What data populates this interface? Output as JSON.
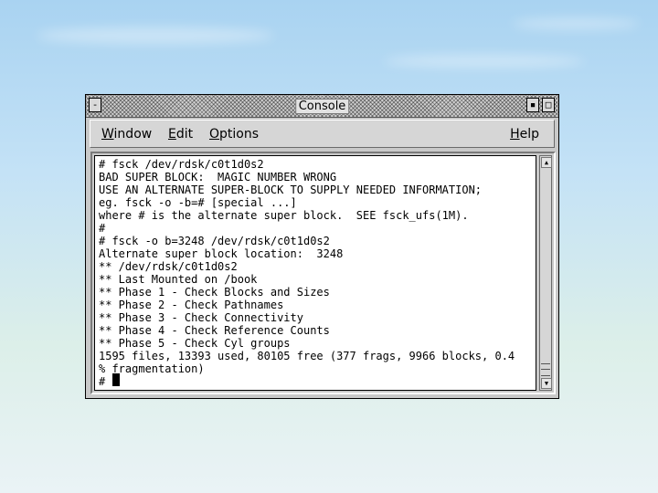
{
  "window": {
    "title": "Console",
    "menu_button_glyph": "-",
    "minimize_glyph": "▪",
    "maximize_glyph": "□"
  },
  "menubar": {
    "window_accel": "W",
    "window_rest": "indow",
    "edit_accel": "E",
    "edit_rest": "dit",
    "options_accel": "O",
    "options_rest": "ptions",
    "help_accel": "H",
    "help_rest": "elp"
  },
  "terminal": {
    "lines": [
      "# fsck /dev/rdsk/c0t1d0s2",
      "BAD SUPER BLOCK:  MAGIC NUMBER WRONG",
      "USE AN ALTERNATE SUPER-BLOCK TO SUPPLY NEEDED INFORMATION;",
      "eg. fsck -o -b=# [special ...]",
      "where # is the alternate super block.  SEE fsck_ufs(1M).",
      "#",
      "# fsck -o b=3248 /dev/rdsk/c0t1d0s2",
      "Alternate super block location:  3248",
      "** /dev/rdsk/c0t1d0s2",
      "** Last Mounted on /book",
      "** Phase 1 - Check Blocks and Sizes",
      "** Phase 2 - Check Pathnames",
      "** Phase 3 - Check Connectivity",
      "** Phase 4 - Check Reference Counts",
      "** Phase 5 - Check Cyl groups",
      "1595 files, 13393 used, 80105 free (377 frags, 9966 blocks, 0.4",
      "% fragmentation)",
      "# "
    ],
    "scroll_up_glyph": "▲",
    "scroll_down_glyph": "▼"
  }
}
